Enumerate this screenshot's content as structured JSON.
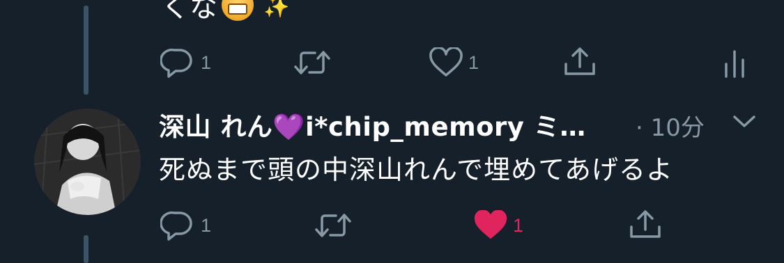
{
  "previous_tweet": {
    "text_fragment": "くな",
    "emoji": [
      "grinning-face-emoji",
      "sparkles-emoji"
    ],
    "actions": {
      "reply_count": "1",
      "retweet_count": "",
      "like_count": "1"
    }
  },
  "reply_tweet": {
    "display_name": "深山 れん💜i*chip_memory ミ…",
    "timestamp": "· 10分",
    "text": "死ぬまで頭の中深山れんで埋めてあげるよ",
    "actions": {
      "reply_count": "1",
      "retweet_count": "",
      "like_count": "1",
      "liked": true
    }
  },
  "icons": [
    "reply-icon",
    "retweet-icon",
    "like-icon",
    "share-icon",
    "analytics-icon",
    "chevron-down-icon"
  ],
  "colors": {
    "background": "#15202b",
    "muted": "#8899a6",
    "like_active": "#e0245e",
    "thread_line": "#3d5466"
  }
}
